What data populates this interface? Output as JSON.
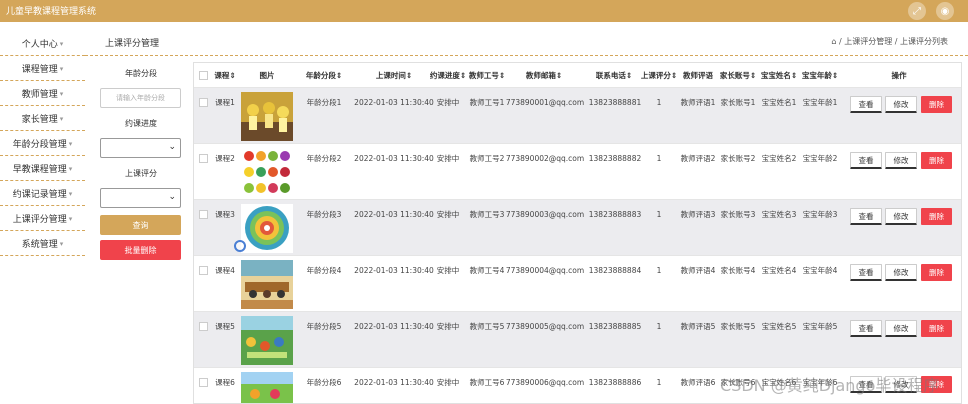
{
  "app": {
    "title": "儿童早教课程管理系统",
    "icons": [
      "fullscreen-icon",
      "user-icon"
    ]
  },
  "sidebar": {
    "items": [
      {
        "label": "个人中心"
      },
      {
        "label": "课程管理"
      },
      {
        "label": "教师管理"
      },
      {
        "label": "家长管理"
      },
      {
        "label": "年龄分段管理"
      },
      {
        "label": "早教课程管理"
      },
      {
        "label": "约课记录管理"
      },
      {
        "label": "上课评分管理"
      },
      {
        "label": "系统管理"
      }
    ]
  },
  "header": {
    "page_title": "上课评分管理",
    "breadcrumb": "⌂ / 上课评分管理 / 上课评分列表"
  },
  "filter": {
    "age_label": "年龄分段",
    "age_placeholder": "请输入年龄分段",
    "progress_label": "约课进度",
    "progress_value": "",
    "score_label": "上课评分",
    "score_value": "",
    "query_button": "查询",
    "batch_delete_button": "批量删除"
  },
  "colors": {
    "brand": "#d4a65a",
    "danger": "#f0434b"
  },
  "table": {
    "headers": [
      "课程⇕",
      "图片",
      "年龄分段⇕",
      "上课时间⇕",
      "约课进度⇕",
      "教师工号⇕",
      "教师邮箱⇕",
      "联系电话⇕",
      "上课评分⇕",
      "教师评语",
      "家长账号⇕",
      "宝宝姓名⇕",
      "宝宝年龄⇕",
      "操作"
    ],
    "rows": [
      {
        "course": "课程1",
        "age": "年龄分段1",
        "time": "2022-01-03 11:30:40",
        "progress": "安排中",
        "teacher_id": "教师工号1",
        "email": "773890001@qq.com",
        "phone": "13823888881",
        "score": "1",
        "comment": "教师评语1",
        "parent": "家长账号1",
        "baby_name": "宝宝姓名1",
        "baby_age": "宝宝年龄1"
      },
      {
        "course": "课程2",
        "age": "年龄分段2",
        "time": "2022-01-03 11:30:40",
        "progress": "安排中",
        "teacher_id": "教师工号2",
        "email": "773890002@qq.com",
        "phone": "13823888882",
        "score": "1",
        "comment": "教师评语2",
        "parent": "家长账号2",
        "baby_name": "宝宝姓名2",
        "baby_age": "宝宝年龄2"
      },
      {
        "course": "课程3",
        "age": "年龄分段3",
        "time": "2022-01-03 11:30:40",
        "progress": "安排中",
        "teacher_id": "教师工号3",
        "email": "773890003@qq.com",
        "phone": "13823888883",
        "score": "1",
        "comment": "教师评语3",
        "parent": "家长账号3",
        "baby_name": "宝宝姓名3",
        "baby_age": "宝宝年龄3"
      },
      {
        "course": "课程4",
        "age": "年龄分段4",
        "time": "2022-01-03 11:30:40",
        "progress": "安排中",
        "teacher_id": "教师工号4",
        "email": "773890004@qq.com",
        "phone": "13823888884",
        "score": "1",
        "comment": "教师评语4",
        "parent": "家长账号4",
        "baby_name": "宝宝姓名4",
        "baby_age": "宝宝年龄4"
      },
      {
        "course": "课程5",
        "age": "年龄分段5",
        "time": "2022-01-03 11:30:40",
        "progress": "安排中",
        "teacher_id": "教师工号5",
        "email": "773890005@qq.com",
        "phone": "13823888885",
        "score": "1",
        "comment": "教师评语5",
        "parent": "家长账号5",
        "baby_name": "宝宝姓名5",
        "baby_age": "宝宝年龄5"
      },
      {
        "course": "课程6",
        "age": "年龄分段6",
        "time": "2022-01-03 11:30:40",
        "progress": "安排中",
        "teacher_id": "教师工号6",
        "email": "773890006@qq.com",
        "phone": "13823888886",
        "score": "1",
        "comment": "教师评语6",
        "parent": "家长账号6",
        "baby_name": "宝宝姓名6",
        "baby_age": "宝宝年龄6"
      }
    ],
    "view_label": "查看",
    "edit_label": "修改",
    "delete_label": "删除"
  },
  "watermark": "CSDN @黄纯Django毕设程序"
}
